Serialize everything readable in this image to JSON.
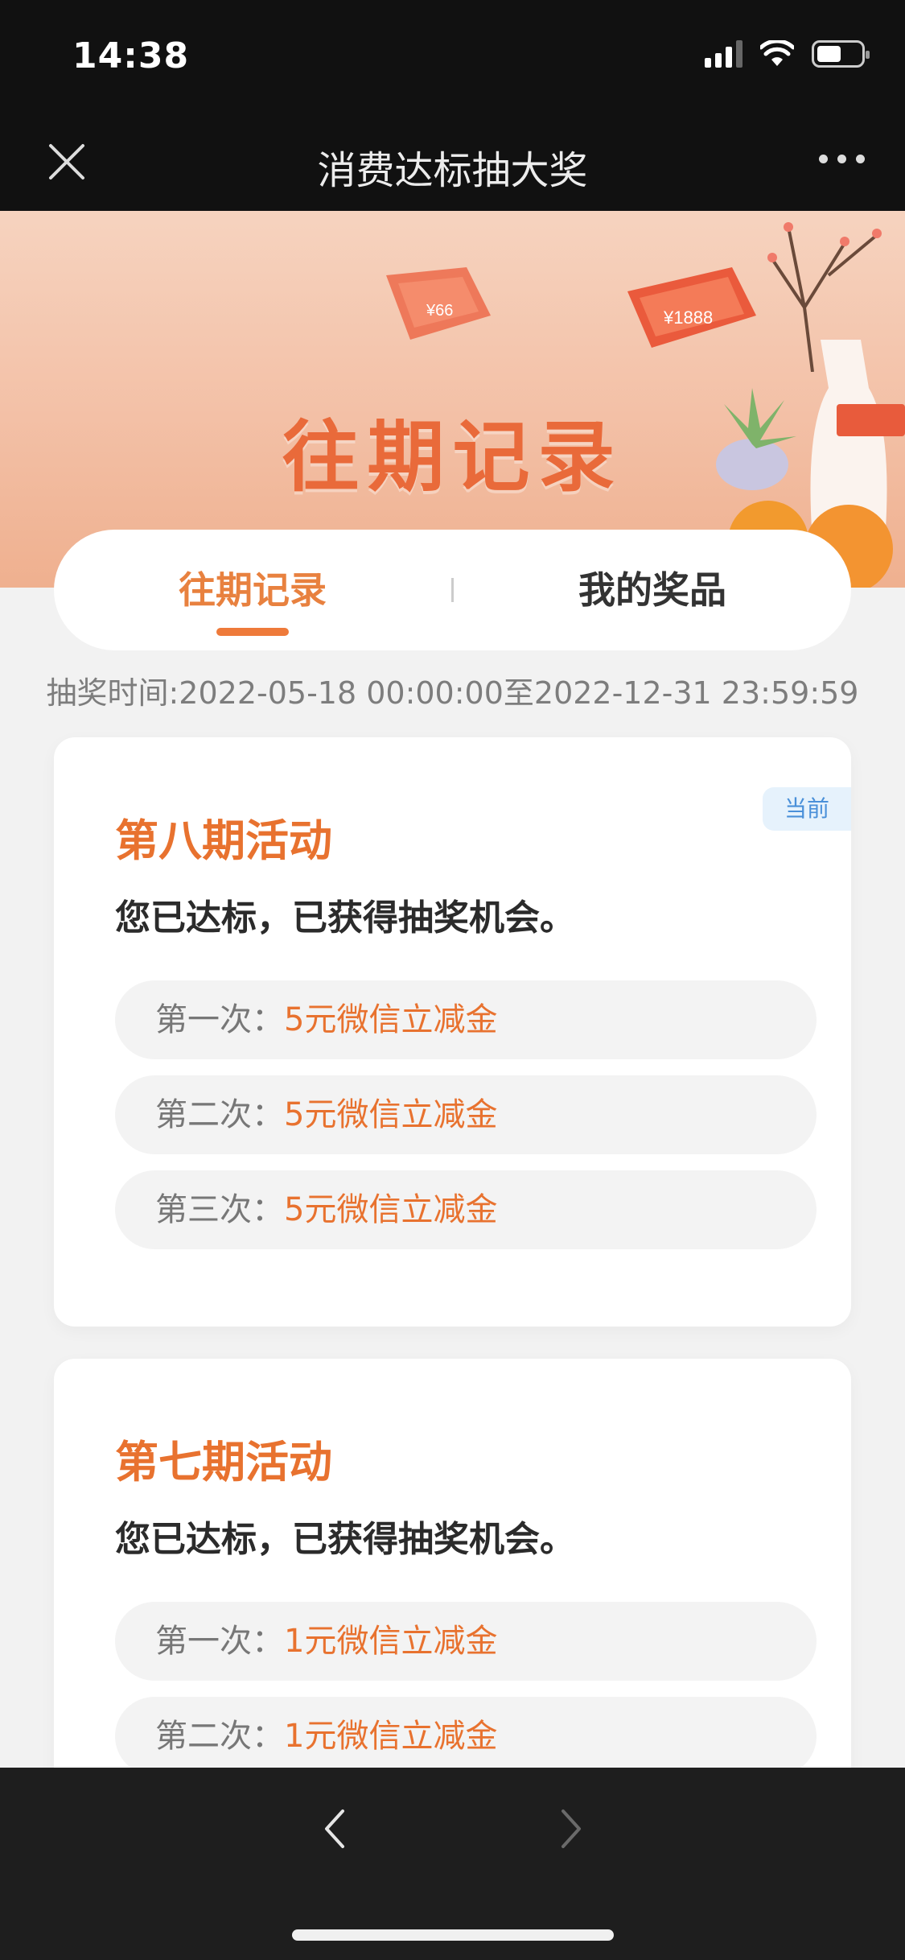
{
  "status_bar": {
    "time": "14:38",
    "battery_level": 0.55
  },
  "nav": {
    "title": "消费达标抽大奖",
    "close_icon": "close-icon",
    "more_icon": "more-dots-icon"
  },
  "banner": {
    "title": "往期记录"
  },
  "tabs": [
    {
      "label": "往期记录",
      "active": true
    },
    {
      "label": "我的奖品",
      "active": false
    }
  ],
  "draw_time": "抽奖时间:2022-05-18 00:00:00至2022-12-31 23:59:59",
  "cards": [
    {
      "title": "第八期活动",
      "badge": "当前",
      "desc": "您已达标，已获得抽奖机会。",
      "prizes": [
        {
          "label": "第一次：",
          "value": "5元微信立减金"
        },
        {
          "label": "第二次：",
          "value": "5元微信立减金"
        },
        {
          "label": "第三次：",
          "value": "5元微信立减金"
        }
      ]
    },
    {
      "title": "第七期活动",
      "desc": "您已达标，已获得抽奖机会。",
      "prizes": [
        {
          "label": "第一次：",
          "value": "1元微信立减金"
        },
        {
          "label": "第二次：",
          "value": "1元微信立减金"
        }
      ]
    }
  ],
  "colors": {
    "accent": "#e8722f",
    "badge_text": "#4a90d9",
    "badge_bg": "#e6f2fc"
  },
  "toolbar": {
    "back_icon": "chevron-left-icon",
    "forward_icon": "chevron-right-icon"
  }
}
